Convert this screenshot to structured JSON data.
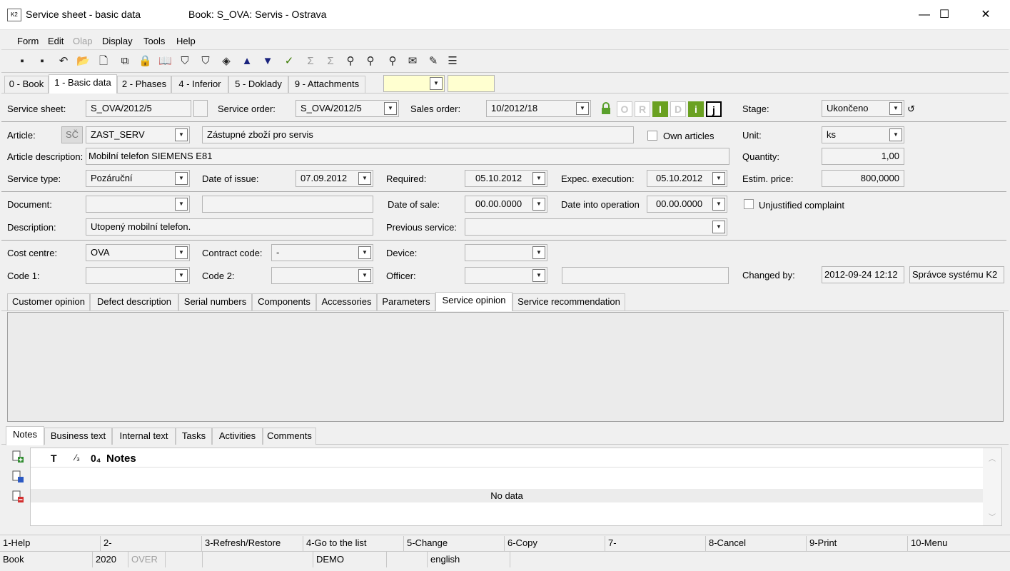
{
  "window": {
    "title": "Service sheet - basic data",
    "book": "Book: S_OVA: Servis - Ostrava",
    "minimize": "—",
    "maximize": "☐",
    "close": "✕",
    "app_icon": "k2-app-icon"
  },
  "menu": {
    "items": [
      "Form",
      "Edit",
      "Olap",
      "Display",
      "Tools",
      "Help"
    ]
  },
  "toolbar": {
    "icons": [
      "save-icon",
      "save-as-icon",
      "undo-icon",
      "open-folder-icon",
      "new-document-icon",
      "copy-documents-icon",
      "lock-icon",
      "book-icon",
      "filter-icon",
      "filter-remove-icon",
      "layers-icon",
      "arrow-up-icon",
      "arrow-down-icon",
      "check-mark-icon",
      "sum-icon",
      "sum-remove-icon",
      "binoculars-icon",
      "binoculars-next-icon",
      "binoculars-prev-icon",
      "email-icon",
      "notepad-icon",
      "menu-lines-icon"
    ],
    "glyphs": [
      "▪",
      "▪",
      "↶",
      "📂",
      "🗋",
      "⧉",
      "🔒",
      "📖",
      "⛉",
      "⛉",
      "◈",
      "▲",
      "▼",
      "✓",
      "Σ",
      "Σ",
      "⚲",
      "⚲",
      "⚲",
      "✉",
      "✎",
      "☰"
    ]
  },
  "main_tabs": [
    "0 - Book",
    "1 - Basic data",
    "2 - Phases",
    "4 - Inferior",
    "5 - Doklady",
    "9 - Attachments"
  ],
  "form": {
    "service_sheet_label": "Service sheet:",
    "service_sheet": "S_OVA/2012/5",
    "service_order_label": "Service order:",
    "service_order": "S_OVA/2012/5",
    "sales_order_label": "Sales order:",
    "sales_order": "10/2012/18",
    "flags": [
      "O",
      "R",
      "I",
      "D",
      "i",
      "j"
    ],
    "stage_label": "Stage:",
    "stage": "Ukončeno",
    "article_label": "Article:",
    "article_prefix": "SČ",
    "article": "ZAST_SERV",
    "article_name": "Zástupné zboží pro servis",
    "own_articles_label": "Own articles",
    "unit_label": "Unit:",
    "unit": "ks",
    "article_description_label": "Article description:",
    "article_description": "Mobilní telefon SIEMENS E81",
    "quantity_label": "Quantity:",
    "quantity": "1,00",
    "service_type_label": "Service type:",
    "service_type": "Pozáruční",
    "date_of_issue_label": "Date of issue:",
    "date_of_issue": "07.09.2012",
    "required_label": "Required:",
    "required": "05.10.2012",
    "expec_execution_label": "Expec. execution:",
    "expec_execution": "05.10.2012",
    "estim_price_label": "Estim. price:",
    "estim_price": "800,0000",
    "document_label": "Document:",
    "date_of_sale_label": "Date of sale:",
    "date_of_sale": "00.00.0000",
    "date_into_operation_label": "Date into operation",
    "date_into_operation": "00.00.0000",
    "unjustified_label": "Unjustified complaint",
    "description_label": "Description:",
    "description": "Utopený mobilní telefon.",
    "previous_service_label": "Previous service:",
    "cost_centre_label": "Cost centre:",
    "cost_centre": "OVA",
    "contract_code_label": "Contract code:",
    "contract_code": "-",
    "device_label": "Device:",
    "code1_label": "Code 1:",
    "code2_label": "Code 2:",
    "officer_label": "Officer:",
    "changed_by_label": "Changed by:",
    "changed_date": "2012-09-24 12:12",
    "changed_user": "Správce systému K2"
  },
  "opinion_tabs": [
    "Customer opinion",
    "Defect description",
    "Serial numbers",
    "Components",
    "Accessories",
    "Parameters",
    "Service opinion",
    "Service recommendation"
  ],
  "notes_tabs": [
    "Notes",
    "Business text",
    "Internal text",
    "Tasks",
    "Activities",
    "Comments"
  ],
  "notes_grid": {
    "col_t": "T",
    "col_sort": "⁄₃",
    "col_num": "0₄",
    "col_notes": "Notes",
    "empty": "No data"
  },
  "fkeys": [
    "1-Help",
    "2-",
    "3-Refresh/Restore",
    "4-Go to the list",
    "5-Change",
    "6-Copy",
    "7-",
    "8-Cancel",
    "9-Print",
    "10-Menu"
  ],
  "status": {
    "book": "Book",
    "year": "2020",
    "over": "OVER",
    "db": "DEMO",
    "lang": "english"
  }
}
